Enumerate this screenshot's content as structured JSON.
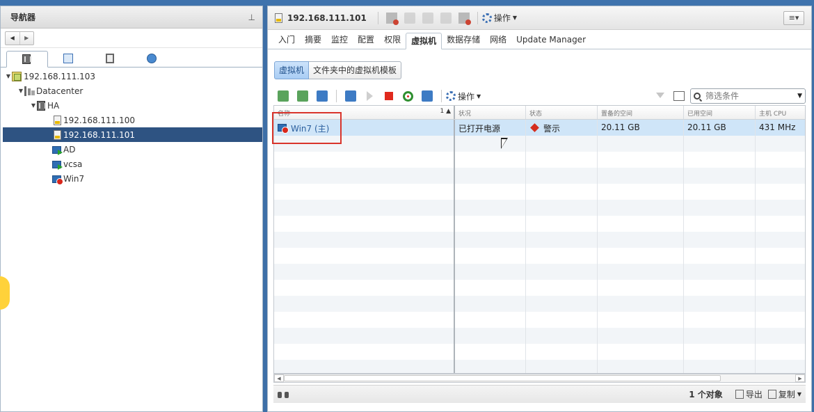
{
  "navigator": {
    "title": "导航器",
    "tree": [
      {
        "label": "192.168.111.103",
        "type": "vcenter"
      },
      {
        "label": "Datacenter",
        "type": "datacenter"
      },
      {
        "label": "HA",
        "type": "cluster"
      },
      {
        "label": "192.168.111.100",
        "type": "host"
      },
      {
        "label": "192.168.111.101",
        "type": "host",
        "selected": true
      },
      {
        "label": "AD",
        "type": "vm"
      },
      {
        "label": "vcsa",
        "type": "vm"
      },
      {
        "label": "Win7",
        "type": "vm-warning"
      }
    ]
  },
  "header": {
    "host": "192.168.111.101",
    "actions": "操作"
  },
  "tabs": [
    "入门",
    "摘要",
    "监控",
    "配置",
    "权限",
    "虚拟机",
    "数据存储",
    "网络",
    "Update Manager"
  ],
  "active_tab": "虚拟机",
  "subtabs": [
    "虚拟机",
    "文件夹中的虚拟机模板"
  ],
  "toolbar": {
    "actions": "操作",
    "filter_placeholder": "筛选条件"
  },
  "table": {
    "columns": [
      "名称",
      "状况",
      "状态",
      "置备的空间",
      "已用空间",
      "主机 CPU"
    ],
    "sort_indicator": "1 ▲",
    "rows": [
      {
        "name": "Win7 (主)",
        "condition": "已打开电源",
        "status": "警示",
        "provisioned": "20.11 GB",
        "used": "20.11 GB",
        "host_cpu": "431 MHz"
      }
    ]
  },
  "footer": {
    "count": "1 个对象",
    "export": "导出",
    "copy": "复制"
  },
  "colors": {
    "selection": "#2e5382",
    "highlight": "#d9342b",
    "accent": "#3b6fb4"
  }
}
